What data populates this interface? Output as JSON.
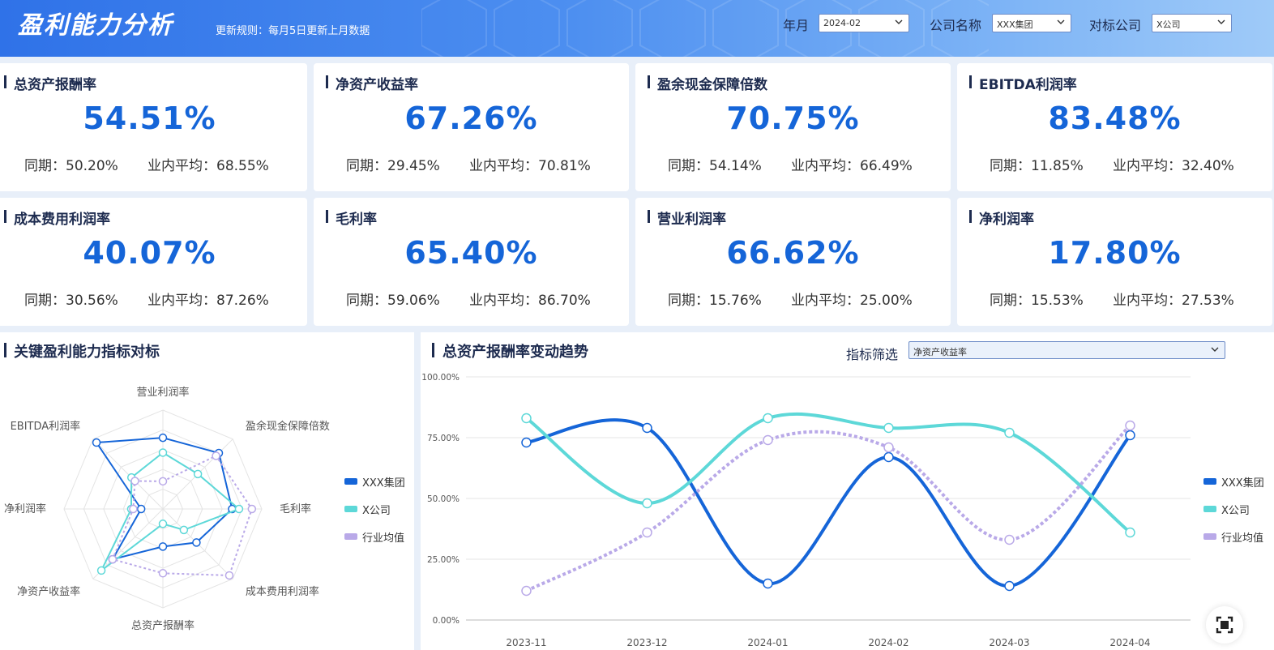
{
  "header": {
    "title": "盈利能力分析",
    "update_rule": "更新规则：每月5日更新上月数据",
    "filters": [
      {
        "label": "年月",
        "value": "2024-02"
      },
      {
        "label": "公司名称",
        "value": "XXX集团"
      },
      {
        "label": "对标公司",
        "value": "X公司"
      }
    ]
  },
  "kpis": [
    {
      "title": "总资产报酬率",
      "value": "54.51%",
      "yoy": "同期：50.20%",
      "avg": "业内平均：68.55%"
    },
    {
      "title": "净资产收益率",
      "value": "67.26%",
      "yoy": "同期：29.45%",
      "avg": "业内平均：70.81%"
    },
    {
      "title": "盈余现金保障倍数",
      "value": "70.75%",
      "yoy": "同期：54.14%",
      "avg": "业内平均：66.49%"
    },
    {
      "title": "EBITDA利润率",
      "value": "83.48%",
      "yoy": "同期：11.85%",
      "avg": "业内平均：32.40%"
    },
    {
      "title": "成本费用利润率",
      "value": "40.07%",
      "yoy": "同期：30.56%",
      "avg": "业内平均：87.26%"
    },
    {
      "title": "毛利率",
      "value": "65.40%",
      "yoy": "同期：59.06%",
      "avg": "业内平均：86.70%"
    },
    {
      "title": "营业利润率",
      "value": "66.62%",
      "yoy": "同期：15.76%",
      "avg": "业内平均：25.00%"
    },
    {
      "title": "净利润率",
      "value": "17.80%",
      "yoy": "同期：15.53%",
      "avg": "业内平均：27.53%"
    }
  ],
  "radar_panel": {
    "title": "关键盈利能力指标对标"
  },
  "trend_panel": {
    "title": "总资产报酬率变动趋势",
    "filter_label": "指标筛选",
    "filter_value": "净资产收益率"
  },
  "legend": [
    "XXX集团",
    "X公司",
    "行业均值"
  ],
  "colors": {
    "group": "#1565d8",
    "company": "#5dd8d8",
    "industry": "#b9a9e8",
    "title_accent": "#1d2b4f"
  },
  "icons": {
    "dropdown": "chevron-down-icon",
    "fullscreen": "fullscreen-icon"
  },
  "chart_data": [
    {
      "type": "radar",
      "indicators": [
        "营业利润率",
        "盈余现金保障倍数",
        "毛利率",
        "成本费用利润率",
        "总资产报酬率",
        "净资产收益率",
        "净利润率",
        "EBITDA利润率"
      ],
      "max": 100,
      "series": [
        {
          "name": "XXX集团",
          "values": [
            72,
            80,
            70,
            48,
            38,
            72,
            22,
            95
          ]
        },
        {
          "name": "X公司",
          "values": [
            57,
            50,
            77,
            30,
            15,
            88,
            32,
            45
          ]
        },
        {
          "name": "行业均值",
          "values": [
            28,
            76,
            90,
            95,
            65,
            72,
            30,
            40
          ]
        }
      ]
    },
    {
      "type": "line",
      "x": [
        "2023-11",
        "2023-12",
        "2024-01",
        "2024-02",
        "2024-03",
        "2024-04"
      ],
      "ylim": [
        0,
        100
      ],
      "yticks": [
        "100.00%",
        "75.00%",
        "50.00%",
        "25.00%",
        "0.00%"
      ],
      "series": [
        {
          "name": "XXX集团",
          "values": [
            73,
            79,
            15,
            67,
            14,
            76
          ]
        },
        {
          "name": "X公司",
          "values": [
            83,
            48,
            83,
            79,
            77,
            36
          ]
        },
        {
          "name": "行业均值",
          "values": [
            12,
            36,
            74,
            71,
            33,
            80
          ]
        }
      ]
    }
  ]
}
